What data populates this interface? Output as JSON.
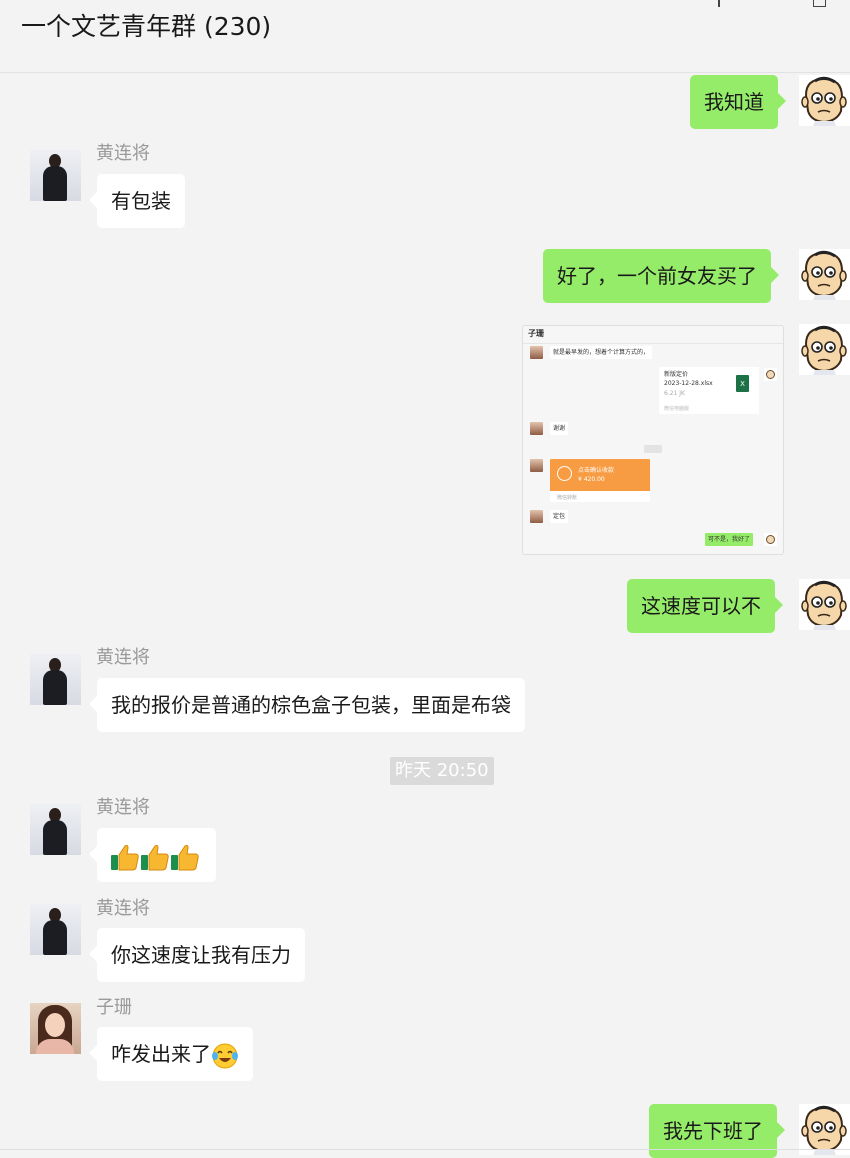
{
  "header": {
    "title": "一个文艺青年群 (230)"
  },
  "messages": {
    "m1": {
      "text": "我知道"
    },
    "m2": {
      "sender": "黄连将",
      "text": "有包装"
    },
    "m3": {
      "text": "好了，一个前女友买了"
    },
    "m5": {
      "text": "这速度可以不"
    },
    "m6": {
      "sender": "黄连将",
      "text": "我的报价是普通的棕色盒子包装，里面是布袋"
    },
    "time": "昨天 20:50",
    "m7": {
      "sender": "黄连将",
      "emoji": "thumbs-up x3"
    },
    "m8": {
      "sender": "黄连将",
      "text": "你这速度让我有压力"
    },
    "m9": {
      "sender": "子珊",
      "text": "咋发出来了",
      "emoji": "laughing-tears"
    },
    "m10": {
      "text": "我先下班了"
    }
  },
  "screenshot": {
    "title": "子珊",
    "msg1": "就是最早发的，想着个计算方式的，",
    "file_name": "新版定价",
    "file_date": "2023-12-28.xlsx",
    "file_size": "6.21 JK",
    "file_meta": "微信电脑版",
    "file_icon": "X",
    "msg2": "谢谢",
    "pay_title": "点击确认收款",
    "pay_amount": "¥ 420.00",
    "pay_footer": "微信转账",
    "msg3": "定包",
    "msg4": "可不是，我好了"
  },
  "colors": {
    "background": "#f3f3f3",
    "outgoing_bubble": "#95ec69",
    "incoming_bubble": "#ffffff"
  }
}
